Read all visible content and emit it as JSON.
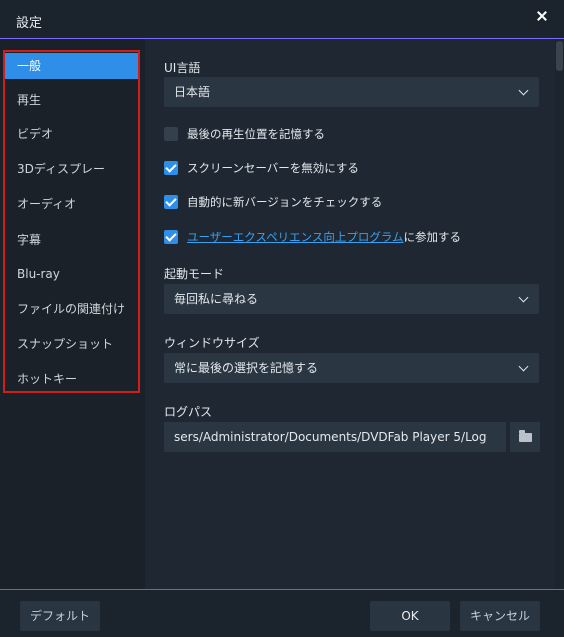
{
  "window": {
    "title": "設定"
  },
  "sidebar": {
    "items": [
      {
        "label": "一般"
      },
      {
        "label": "再生"
      },
      {
        "label": "ビデオ"
      },
      {
        "label": "3Dディスプレー"
      },
      {
        "label": "オーディオ"
      },
      {
        "label": "字幕"
      },
      {
        "label": "Blu-ray"
      },
      {
        "label": "ファイルの関連付け"
      },
      {
        "label": "スナップショット"
      },
      {
        "label": "ホットキー"
      }
    ],
    "active_index": 0
  },
  "general": {
    "ui_language": {
      "label": "UI言語",
      "value": "日本語"
    },
    "checkboxes": [
      {
        "label": "最後の再生位置を記憶する",
        "checked": false
      },
      {
        "label": "スクリーンセーバーを無効にする",
        "checked": true
      },
      {
        "label": "自動的に新バージョンをチェックする",
        "checked": true
      },
      {
        "link": "ユーザーエクスペリエンス向上プログラム",
        "suffix": "に参加する",
        "checked": true
      }
    ],
    "startup_mode": {
      "label": "起動モード",
      "value": "毎回私に尋ねる"
    },
    "window_size": {
      "label": "ウィンドウサイズ",
      "value": "常に最後の選択を記憶する"
    },
    "log_path": {
      "label": "ログパス",
      "value": "sers/Administrator/Documents/DVDFab Player 5/Log"
    }
  },
  "footer": {
    "default_label": "デフォルト",
    "ok_label": "OK",
    "cancel_label": "キャンセル"
  },
  "colors": {
    "accent": "#2f8fe8",
    "highlight_frame": "#d21d1d",
    "background": "#1f2832"
  }
}
